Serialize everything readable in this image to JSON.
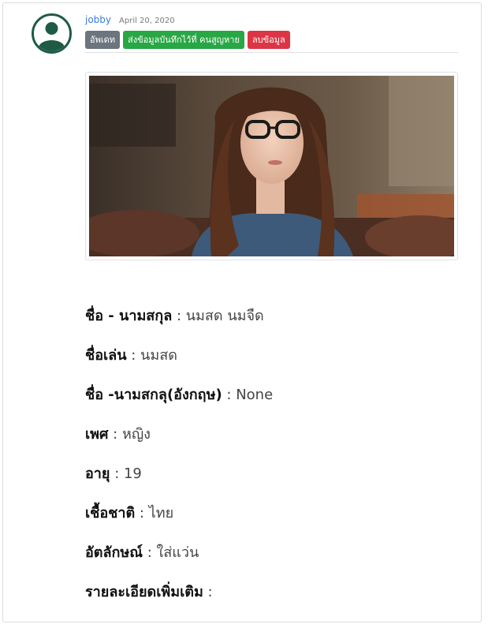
{
  "post": {
    "author": "jobby",
    "date": "April 20, 2020",
    "actions": {
      "update_label": "อัพเดท",
      "send_label": "ส่งข้อมูลบันทึกไว้ที่ คนสูญหาย",
      "delete_label": "ลบข้อมูล"
    },
    "photo_icon": "person-photo",
    "avatar_icon": "user-avatar-icon"
  },
  "details": [
    {
      "label": "ชื่อ - นามสกุล",
      "value": "นมสด นมจืด"
    },
    {
      "label": "ชื่อเล่น",
      "value": "นมสด"
    },
    {
      "label": "ชื่อ -นามสกลุ(อังกฤษ)",
      "value": "None"
    },
    {
      "label": "เพศ",
      "value": "หญิง"
    },
    {
      "label": "อายุ",
      "value": "19"
    },
    {
      "label": "เชื้อชาติ",
      "value": "ไทย"
    },
    {
      "label": "อัตลักษณ์",
      "value": "ใส่แว่น"
    },
    {
      "label": "รายละเอียดเพิ่มเติม",
      "value": ""
    }
  ],
  "separator": " : ",
  "colors": {
    "avatar": "#1e5b45",
    "link": "#3b7dd8",
    "update": "#6c757d",
    "send": "#28a745",
    "delete": "#dc3545"
  }
}
